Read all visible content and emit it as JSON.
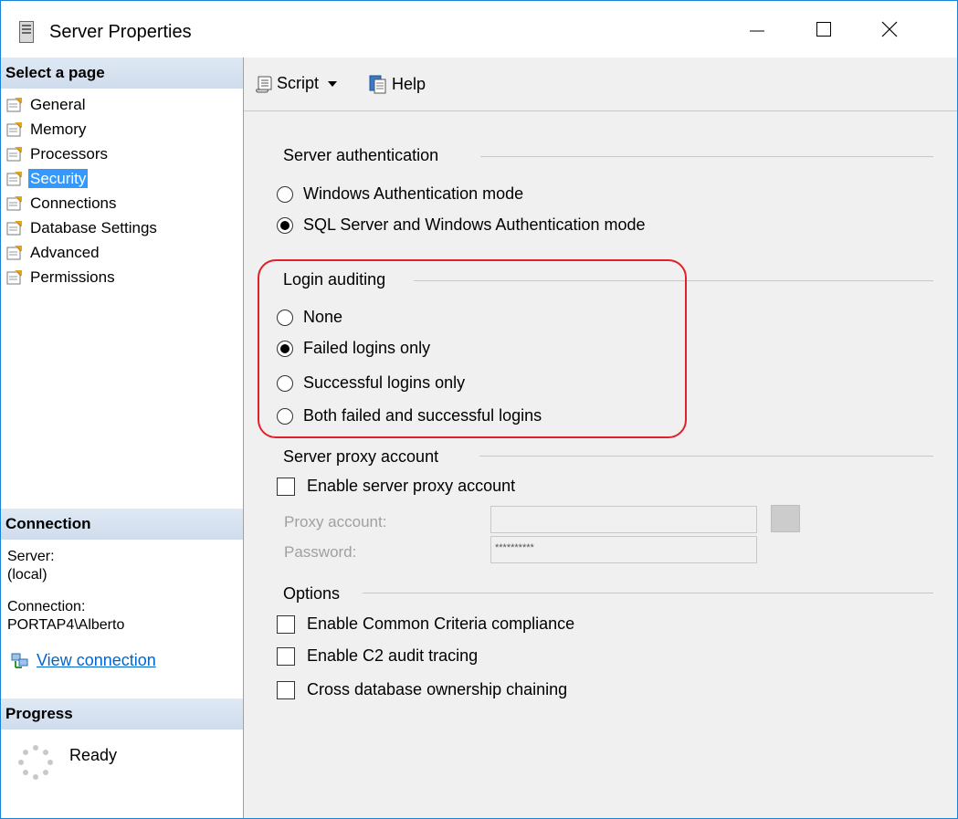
{
  "window": {
    "title": "Server Properties"
  },
  "left": {
    "select_header": "Select a page",
    "pages": [
      {
        "label": "General",
        "selected": false
      },
      {
        "label": "Memory",
        "selected": false
      },
      {
        "label": "Processors",
        "selected": false
      },
      {
        "label": "Security",
        "selected": true
      },
      {
        "label": "Connections",
        "selected": false
      },
      {
        "label": "Database Settings",
        "selected": false
      },
      {
        "label": "Advanced",
        "selected": false
      },
      {
        "label": "Permissions",
        "selected": false
      }
    ],
    "connection_header": "Connection",
    "server_label": "Server:",
    "server_value": "(local)",
    "connection_label": "Connection:",
    "connection_value": "PORTAP4\\Alberto",
    "view_connection": "View connection",
    "progress_header": "Progress",
    "progress_status": "Ready"
  },
  "toolbar": {
    "script_label": "Script",
    "help_label": "Help"
  },
  "server_auth": {
    "title": "Server authentication",
    "options": [
      {
        "label": "Windows Authentication mode",
        "checked": false
      },
      {
        "label": "SQL Server and Windows Authentication mode",
        "checked": true
      }
    ]
  },
  "login_auditing": {
    "title": "Login auditing",
    "options": [
      {
        "label": "None",
        "checked": false
      },
      {
        "label": "Failed logins only",
        "checked": true
      },
      {
        "label": "Successful logins only",
        "checked": false
      },
      {
        "label": "Both failed and successful logins",
        "checked": false
      }
    ]
  },
  "proxy": {
    "title": "Server proxy account",
    "enable_label": "Enable server proxy account",
    "enable_checked": false,
    "account_label": "Proxy account:",
    "account_value": "",
    "password_label": "Password:",
    "password_value": "**********"
  },
  "options": {
    "title": "Options",
    "items": [
      {
        "label": "Enable Common Criteria compliance",
        "checked": false
      },
      {
        "label": "Enable C2 audit tracing",
        "checked": false
      },
      {
        "label": "Cross database ownership chaining",
        "checked": false
      }
    ]
  },
  "colors": {
    "accent": "#3399ff",
    "highlight_border": "#e0202a",
    "link": "#0066cc"
  }
}
